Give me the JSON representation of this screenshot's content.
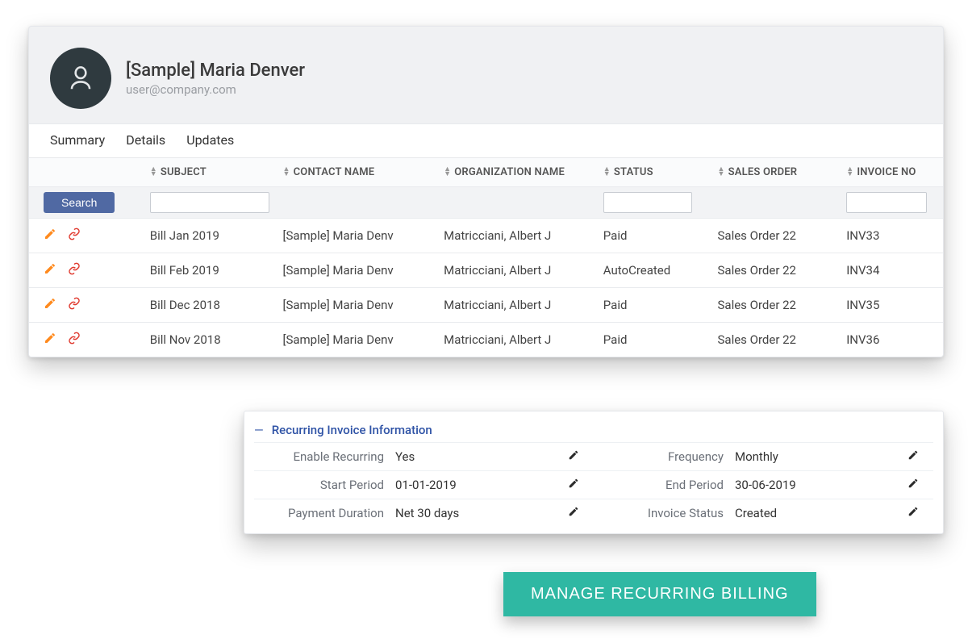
{
  "header": {
    "user_name": "[Sample] Maria Denver",
    "user_email": "user@company.com"
  },
  "tabs": [
    "Summary",
    "Details",
    "Updates"
  ],
  "table": {
    "columns": {
      "subject": "SUBJECT",
      "contact": "CONTACT NAME",
      "org": "ORGANIZATION NAME",
      "status": "STATUS",
      "sales": "SALES ORDER",
      "invoice": "INVOICE NO"
    },
    "search_label": "Search",
    "rows": [
      {
        "subject": "Bill Jan 2019",
        "contact": "[Sample] Maria Denv",
        "org": "Matricciani, Albert J",
        "status": "Paid",
        "sales": "Sales Order 22",
        "invoice": "INV33"
      },
      {
        "subject": "Bill Feb 2019",
        "contact": "[Sample] Maria Denv",
        "org": "Matricciani, Albert J",
        "status": "AutoCreated",
        "sales": "Sales Order 22",
        "invoice": "INV34"
      },
      {
        "subject": "Bill Dec 2018",
        "contact": "[Sample] Maria Denv",
        "org": "Matricciani, Albert J",
        "status": "Paid",
        "sales": "Sales Order 22",
        "invoice": "INV35"
      },
      {
        "subject": "Bill Nov 2018",
        "contact": "[Sample] Maria Denv",
        "org": "Matricciani, Albert J",
        "status": "Paid",
        "sales": "Sales Order 22",
        "invoice": "INV36"
      }
    ]
  },
  "recurring": {
    "title": "Recurring Invoice Information",
    "fields": {
      "enable_label": "Enable Recurring",
      "enable_value": "Yes",
      "freq_label": "Frequency",
      "freq_value": "Monthly",
      "start_label": "Start Period",
      "start_value": "01-01-2019",
      "end_label": "End Period",
      "end_value": "30-06-2019",
      "pay_label": "Payment Duration",
      "pay_value": "Net 30 days",
      "inv_label": "Invoice Status",
      "inv_value": "Created"
    }
  },
  "cta": {
    "label": "MANAGE RECURRING BILLING"
  }
}
